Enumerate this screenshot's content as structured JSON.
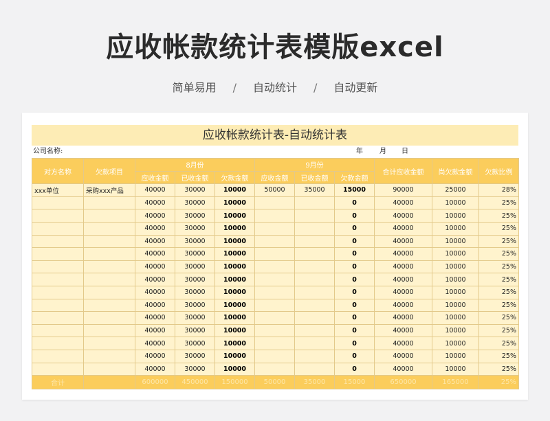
{
  "hero": {
    "title": "应收帐款统计表模版excel",
    "features": [
      "简单易用",
      "自动统计",
      "自动更新"
    ],
    "separator": "/"
  },
  "sheet": {
    "title": "应收帐款统计表-自动统计表",
    "company_label": "公司名称:",
    "year_label": "年",
    "month_label": "月",
    "day_label": "日",
    "headers": {
      "party": "对方名称",
      "item": "欠款项目",
      "month1": "8月份",
      "month2": "9月份",
      "receivable": "应收金额",
      "received": "已收金额",
      "owed": "欠款金额",
      "total_receivable": "合计应收金额",
      "remaining": "尚欠款金额",
      "ratio": "欠款比例"
    },
    "rows": [
      {
        "party": "xxx单位",
        "item": "采购xxx产品",
        "m1_rec": "40000",
        "m1_got": "30000",
        "m1_owe": "10000",
        "m2_rec": "50000",
        "m2_got": "35000",
        "m2_owe": "15000",
        "total": "90000",
        "remain": "25000",
        "ratio": "28%"
      },
      {
        "party": "",
        "item": "",
        "m1_rec": "40000",
        "m1_got": "30000",
        "m1_owe": "10000",
        "m2_rec": "",
        "m2_got": "",
        "m2_owe": "0",
        "total": "40000",
        "remain": "10000",
        "ratio": "25%"
      },
      {
        "party": "",
        "item": "",
        "m1_rec": "40000",
        "m1_got": "30000",
        "m1_owe": "10000",
        "m2_rec": "",
        "m2_got": "",
        "m2_owe": "0",
        "total": "40000",
        "remain": "10000",
        "ratio": "25%"
      },
      {
        "party": "",
        "item": "",
        "m1_rec": "40000",
        "m1_got": "30000",
        "m1_owe": "10000",
        "m2_rec": "",
        "m2_got": "",
        "m2_owe": "0",
        "total": "40000",
        "remain": "10000",
        "ratio": "25%"
      },
      {
        "party": "",
        "item": "",
        "m1_rec": "40000",
        "m1_got": "30000",
        "m1_owe": "10000",
        "m2_rec": "",
        "m2_got": "",
        "m2_owe": "0",
        "total": "40000",
        "remain": "10000",
        "ratio": "25%"
      },
      {
        "party": "",
        "item": "",
        "m1_rec": "40000",
        "m1_got": "30000",
        "m1_owe": "10000",
        "m2_rec": "",
        "m2_got": "",
        "m2_owe": "0",
        "total": "40000",
        "remain": "10000",
        "ratio": "25%"
      },
      {
        "party": "",
        "item": "",
        "m1_rec": "40000",
        "m1_got": "30000",
        "m1_owe": "10000",
        "m2_rec": "",
        "m2_got": "",
        "m2_owe": "0",
        "total": "40000",
        "remain": "10000",
        "ratio": "25%"
      },
      {
        "party": "",
        "item": "",
        "m1_rec": "40000",
        "m1_got": "30000",
        "m1_owe": "10000",
        "m2_rec": "",
        "m2_got": "",
        "m2_owe": "0",
        "total": "40000",
        "remain": "10000",
        "ratio": "25%"
      },
      {
        "party": "",
        "item": "",
        "m1_rec": "40000",
        "m1_got": "30000",
        "m1_owe": "10000",
        "m2_rec": "",
        "m2_got": "",
        "m2_owe": "0",
        "total": "40000",
        "remain": "10000",
        "ratio": "25%"
      },
      {
        "party": "",
        "item": "",
        "m1_rec": "40000",
        "m1_got": "30000",
        "m1_owe": "10000",
        "m2_rec": "",
        "m2_got": "",
        "m2_owe": "0",
        "total": "40000",
        "remain": "10000",
        "ratio": "25%"
      },
      {
        "party": "",
        "item": "",
        "m1_rec": "40000",
        "m1_got": "30000",
        "m1_owe": "10000",
        "m2_rec": "",
        "m2_got": "",
        "m2_owe": "0",
        "total": "40000",
        "remain": "10000",
        "ratio": "25%"
      },
      {
        "party": "",
        "item": "",
        "m1_rec": "40000",
        "m1_got": "30000",
        "m1_owe": "10000",
        "m2_rec": "",
        "m2_got": "",
        "m2_owe": "0",
        "total": "40000",
        "remain": "10000",
        "ratio": "25%"
      },
      {
        "party": "",
        "item": "",
        "m1_rec": "40000",
        "m1_got": "30000",
        "m1_owe": "10000",
        "m2_rec": "",
        "m2_got": "",
        "m2_owe": "0",
        "total": "40000",
        "remain": "10000",
        "ratio": "25%"
      },
      {
        "party": "",
        "item": "",
        "m1_rec": "40000",
        "m1_got": "30000",
        "m1_owe": "10000",
        "m2_rec": "",
        "m2_got": "",
        "m2_owe": "0",
        "total": "40000",
        "remain": "10000",
        "ratio": "25%"
      },
      {
        "party": "",
        "item": "",
        "m1_rec": "40000",
        "m1_got": "30000",
        "m1_owe": "10000",
        "m2_rec": "",
        "m2_got": "",
        "m2_owe": "0",
        "total": "40000",
        "remain": "10000",
        "ratio": "25%"
      }
    ],
    "footer": {
      "label": "合计",
      "m1_rec": "600000",
      "m1_got": "450000",
      "m1_owe": "150000",
      "m2_rec": "50000",
      "m2_got": "35000",
      "m2_owe": "15000",
      "total": "650000",
      "remain": "165000",
      "ratio": "25%"
    }
  },
  "colors": {
    "header_bg": "#fbcd5c",
    "row_bg": "#fff3cd",
    "title_bg": "#fdecb5"
  }
}
